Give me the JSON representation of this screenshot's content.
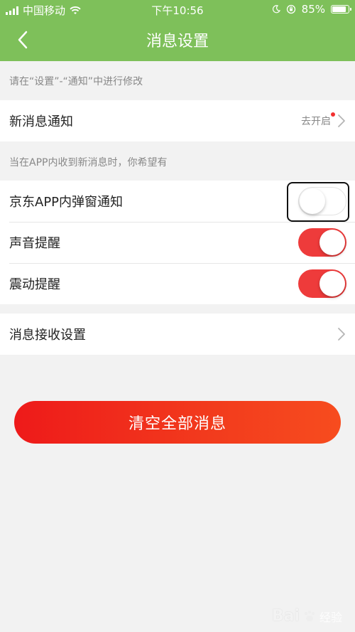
{
  "status_bar": {
    "carrier": "中国移动",
    "time": "下午10:56",
    "battery": "85%",
    "battery_level": 0.85
  },
  "nav": {
    "title": "消息设置",
    "back_icon": "chevron-left-icon"
  },
  "hint_top": "请在“设置”-“通知”中进行修改",
  "new_message": {
    "label": "新消息通知",
    "value": "去开启"
  },
  "hint_mid": "当在APP内收到新消息时，你希望有",
  "toggles": [
    {
      "label": "京东APP内弹窗通知",
      "on": false
    },
    {
      "label": "声音提醒",
      "on": true
    },
    {
      "label": "震动提醒",
      "on": true
    }
  ],
  "receive_settings": {
    "label": "消息接收设置"
  },
  "clear_button": "清空全部消息",
  "watermark": "经验",
  "colors": {
    "header": "#7ec05a",
    "accent_red": "#ee3b3b",
    "background": "#f2f2f2"
  }
}
